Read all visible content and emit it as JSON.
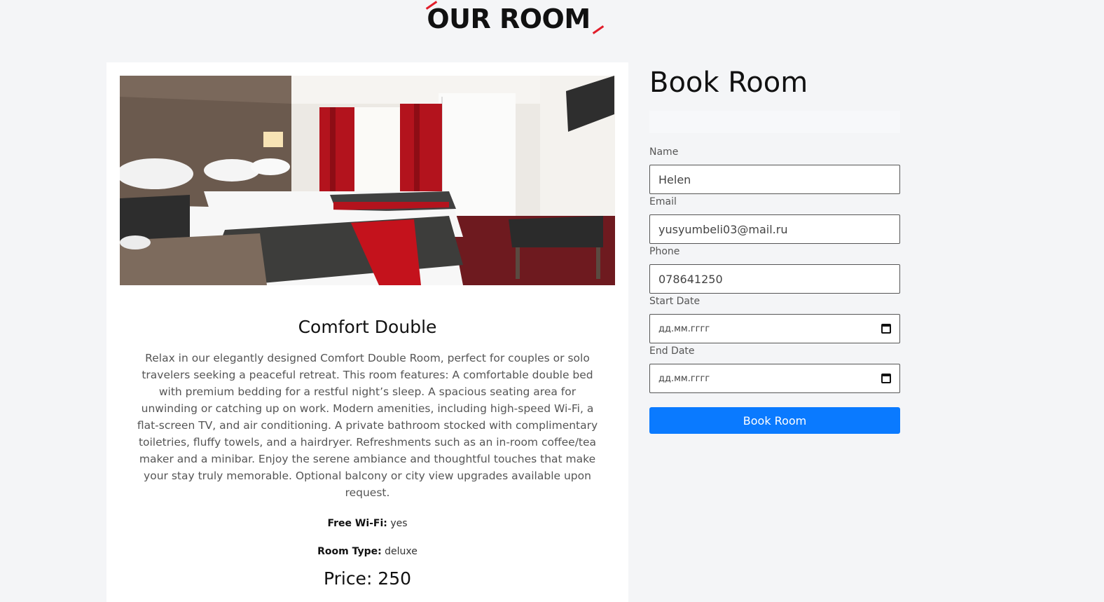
{
  "section": {
    "heading": "OUR ROOM"
  },
  "room": {
    "name": "Comfort Double",
    "description": "Relax in our elegantly designed Comfort Double Room, perfect for couples or solo travelers seeking a peaceful retreat. This room features: A comfortable double bed with premium bedding for a restful night’s sleep. A spacious seating area for unwinding or catching up on work. Modern amenities, including high-speed Wi-Fi, a flat-screen TV, and air conditioning. A private bathroom stocked with complimentary toiletries, fluffy towels, and a hairdryer. Refreshments such as an in-room coffee/tea maker and a minibar. Enjoy the serene ambiance and thoughtful touches that make your stay truly memorable. Optional balcony or city view upgrades available upon request.",
    "wifi_label": "Free Wi-Fi:",
    "wifi_value": "yes",
    "type_label": "Room Type:",
    "type_value": "deluxe",
    "price_text": "Price: 250"
  },
  "booking": {
    "title": "Book Room",
    "name_label": "Name",
    "name_value": "Helen",
    "email_label": "Email",
    "email_value": "yusyumbeli03@mail.ru",
    "phone_label": "Phone",
    "phone_value": "078641250",
    "start_label": "Start Date",
    "start_value": "дд.мм.гггг",
    "end_label": "End Date",
    "end_value": "дд.мм.гггг",
    "submit_label": "Book Room"
  },
  "colors": {
    "accent": "#e11d2a",
    "primary_button": "#0a7aff"
  },
  "icons": {
    "date_picker": "calendar-icon"
  }
}
